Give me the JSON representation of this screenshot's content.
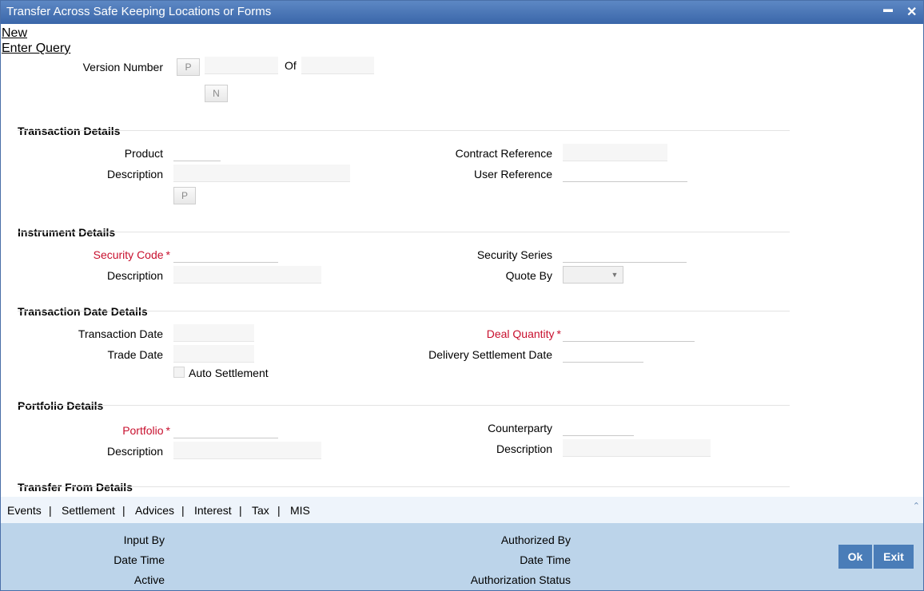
{
  "window": {
    "title": "Transfer Across Safe Keeping Locations or Forms",
    "minimize_glyph": "▬",
    "close_glyph": "✕"
  },
  "menu": {
    "new_label": "New",
    "enter_query_label": "Enter Query"
  },
  "version": {
    "label": "Version Number",
    "prev_button": "P",
    "of_label": "Of",
    "next_button": "N",
    "current_value": "",
    "total_value": ""
  },
  "transaction_details": {
    "heading": "Transaction Details",
    "product_label": "Product",
    "product_value": "",
    "description_label": "Description",
    "description_value": "",
    "pick_button": "P",
    "contract_reference_label": "Contract Reference",
    "contract_reference_value": "",
    "user_reference_label": "User Reference",
    "user_reference_value": ""
  },
  "instrument_details": {
    "heading": "Instrument Details",
    "security_code_label": "Security Code",
    "security_code_value": "",
    "description_label": "Description",
    "description_value": "",
    "security_series_label": "Security Series",
    "security_series_value": "",
    "quote_by_label": "Quote By",
    "quote_by_selected": ""
  },
  "transaction_date_details": {
    "heading": "Transaction Date Details",
    "transaction_date_label": "Transaction Date",
    "transaction_date_value": "",
    "trade_date_label": "Trade Date",
    "trade_date_value": "",
    "auto_settlement_label": "Auto Settlement",
    "deal_quantity_label": "Deal Quantity",
    "deal_quantity_value": "",
    "delivery_settlement_date_label": "Delivery Settlement Date",
    "delivery_settlement_date_value": ""
  },
  "portfolio_details": {
    "heading": "Portfolio Details",
    "portfolio_label": "Portfolio",
    "portfolio_value": "",
    "description_label": "Description",
    "description_value": "",
    "counterparty_label": "Counterparty",
    "counterparty_value": "",
    "cp_description_label": "Description",
    "cp_description_value": ""
  },
  "transfer_from_details": {
    "heading": "Transfer From Details"
  },
  "required_marker": "*",
  "tabs": {
    "events": "Events",
    "settlement": "Settlement",
    "advices": "Advices",
    "interest": "Interest",
    "tax": "Tax",
    "mis": "MIS",
    "separator": "|",
    "scroll_glyph": "⌃"
  },
  "footer": {
    "input_by_label": "Input By",
    "date_time_label": "Date Time",
    "active_label": "Active",
    "authorized_by_label": "Authorized By",
    "auth_date_time_label": "Date Time",
    "authorization_status_label": "Authorization Status",
    "ok_button": "Ok",
    "exit_button": "Exit"
  },
  "colors": {
    "titlebar": "#3a66a9",
    "required": "#c8102e",
    "footer": "#bcd4ea",
    "button": "#4a7db8"
  }
}
